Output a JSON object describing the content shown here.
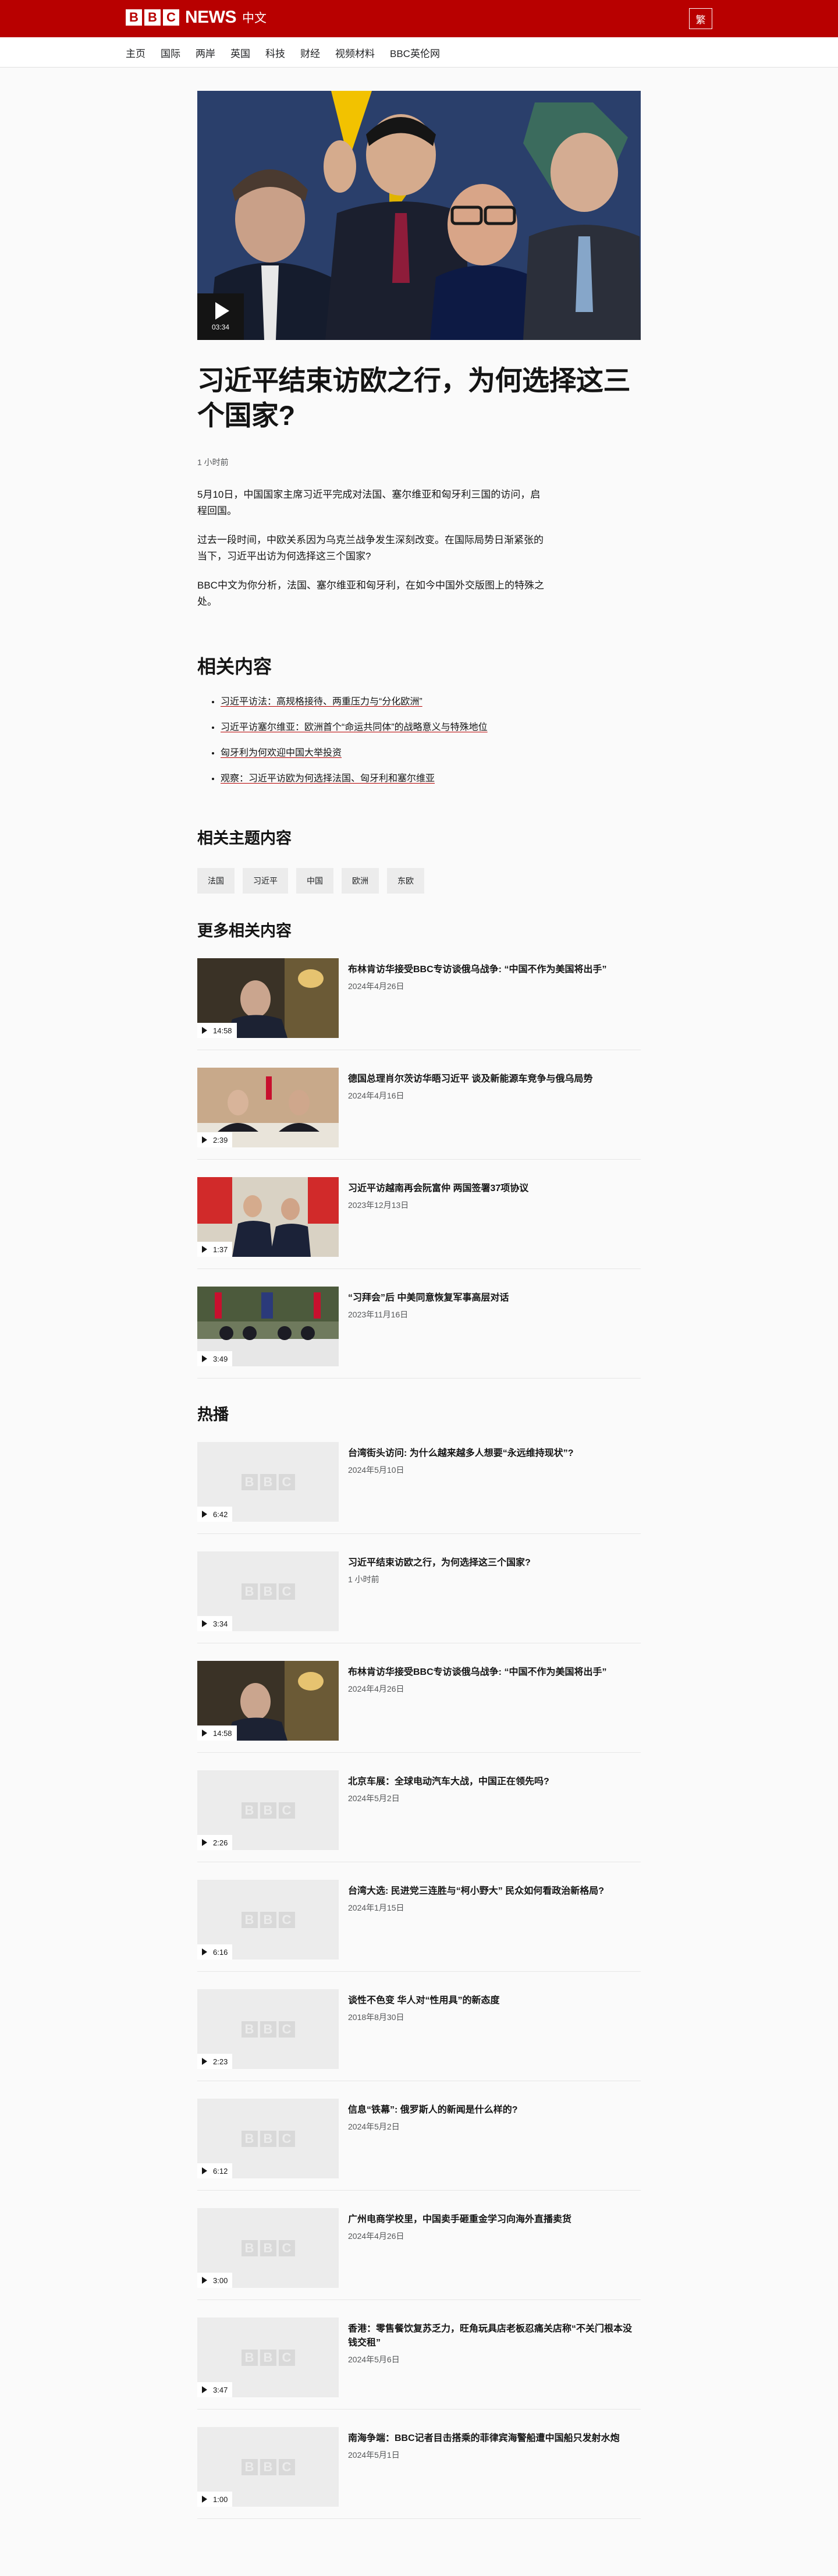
{
  "header": {
    "logo_letters": [
      "B",
      "B",
      "C"
    ],
    "logo_news": "NEWS",
    "logo_lang": "中文",
    "trad_button": "繁",
    "colors": {
      "brand": "#b80000"
    }
  },
  "nav": {
    "items": [
      "主页",
      "国际",
      "两岸",
      "英国",
      "科技",
      "财经",
      "视频材料",
      "BBC英伦网"
    ]
  },
  "hero": {
    "duration": "03:34",
    "play_icon": "play-icon"
  },
  "article": {
    "headline": "习近平结束访欧之行，为何选择这三个国家?",
    "timestamp": "1 小时前",
    "paragraphs": [
      "5月10日，中国国家主席习近平完成对法国、塞尔维亚和匈牙利三国的访问，启程回国。",
      "过去一段时间，中欧关系因为乌克兰战争发生深刻改变。在国际局势日渐紧张的当下，习近平出访为何选择这三个国家?",
      "BBC中文为你分析，法国、塞尔维亚和匈牙利，在如今中国外交版图上的特殊之处。"
    ]
  },
  "related": {
    "heading": "相关内容",
    "items": [
      "习近平访法：高规格接待、两重压力与“分化欧洲”",
      "习近平访塞尔维亚：欧洲首个“命运共同体”的战略意义与特殊地位",
      "匈牙利为何欢迎中国大举投资",
      "观察：习近平访欧为何选择法国、匈牙利和塞尔维亚"
    ]
  },
  "topics": {
    "heading": "相关主题内容",
    "items": [
      "法国",
      "习近平",
      "中国",
      "欧洲",
      "东欧"
    ]
  },
  "more": {
    "heading": "更多相关内容",
    "items": [
      {
        "title": "布林肯访华接受BBC专访谈俄乌战争: “中国不作为美国将出手”",
        "date": "2024年4月26日",
        "duration": "14:58"
      },
      {
        "title": "德国总理肖尔茨访华晤习近平 谈及新能源车竞争与俄乌局势",
        "date": "2024年4月16日",
        "duration": "2:39"
      },
      {
        "title": "习近平访越南再会阮富仲 两国签署37项协议",
        "date": "2023年12月13日",
        "duration": "1:37"
      },
      {
        "title": "“习拜会”后 中美同意恢复军事高层对话",
        "date": "2023年11月16日",
        "duration": "3:49"
      }
    ]
  },
  "hot": {
    "heading": "热播",
    "items": [
      {
        "title": "台湾街头访问: 为什么越来越多人想要“永远维持现状”?",
        "date": "2024年5月10日",
        "duration": "6:42"
      },
      {
        "title": "习近平结束访欧之行，为何选择这三个国家?",
        "date": "1 小时前",
        "duration": "3:34"
      },
      {
        "title": "布林肯访华接受BBC专访谈俄乌战争: “中国不作为美国将出手”",
        "date": "2024年4月26日",
        "duration": "14:58"
      },
      {
        "title": "北京车展：全球电动汽车大战，中国正在领先吗?",
        "date": "2024年5月2日",
        "duration": "2:26"
      },
      {
        "title": "台湾大选: 民进党三连胜与“柯小野大” 民众如何看政治新格局?",
        "date": "2024年1月15日",
        "duration": "6:16"
      },
      {
        "title": "谈性不色变 华人对“性用具”的新态度",
        "date": "2018年8月30日",
        "duration": "2:23"
      },
      {
        "title": "信息“铁幕”: 俄罗斯人的新闻是什么样的?",
        "date": "2024年5月2日",
        "duration": "6:12"
      },
      {
        "title": "广州电商学校里，中国卖手砸重金学习向海外直播卖货",
        "date": "2024年4月26日",
        "duration": "3:00"
      },
      {
        "title": "香港：零售餐饮复苏乏力，旺角玩具店老板忍痛关店称“不关门根本没钱交租”",
        "date": "2024年5月6日",
        "duration": "3:47"
      },
      {
        "title": "南海争端：BBC记者目击搭乘的菲律宾海警船遭中国船只发射水炮",
        "date": "2024年5月1日",
        "duration": "1:00"
      }
    ]
  }
}
